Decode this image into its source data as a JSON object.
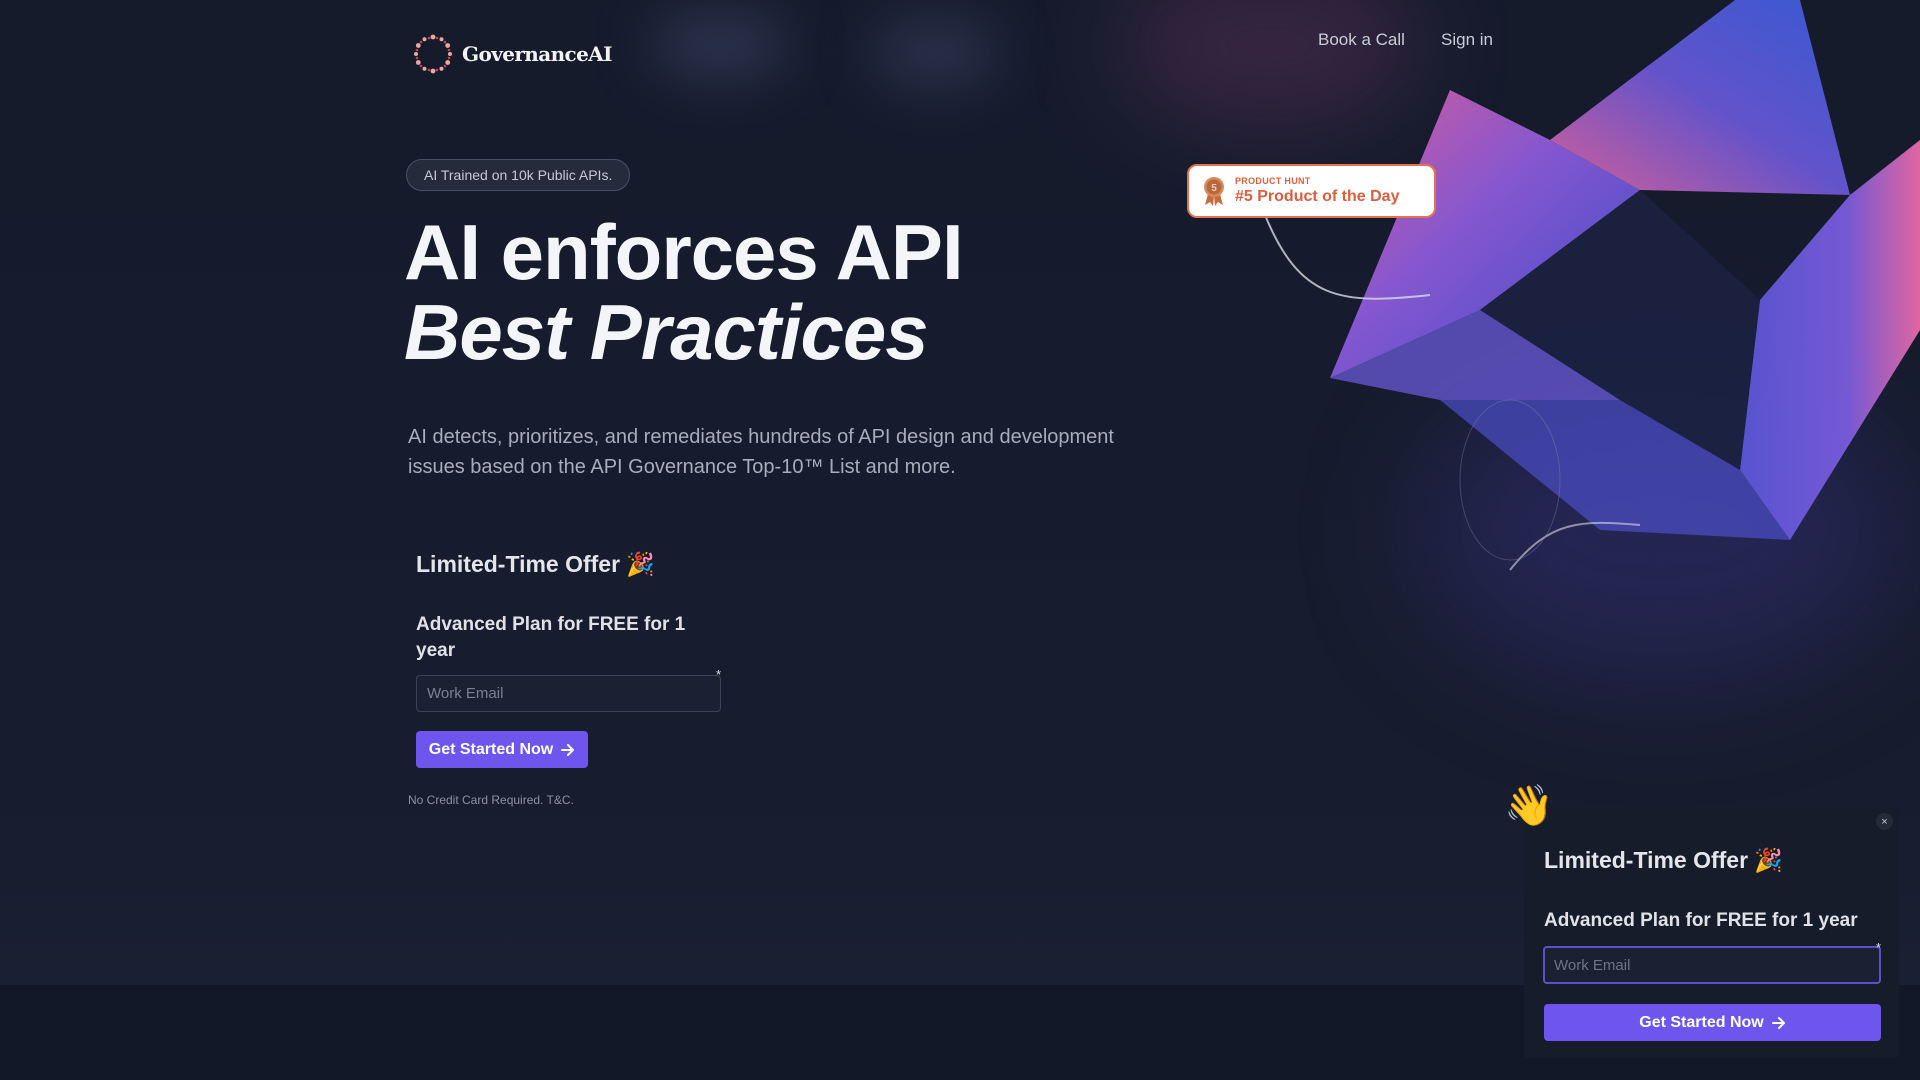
{
  "brand": {
    "name": "GovernanceAI",
    "accent": "#6d55ee"
  },
  "nav": {
    "book_call": "Book a Call",
    "sign_in": "Sign in"
  },
  "hero": {
    "pill": "AI Trained on 10k Public APIs.",
    "headline_line1": "AI enforces API",
    "headline_line2": "Best Practices",
    "subtext": "AI detects, prioritizes, and remediates hundreds of API design and development issues based on the API Governance Top-10™ List and more."
  },
  "form": {
    "offer_title": "Limited-Time Offer 🎉",
    "plan_title": "Advanced Plan for FREE for 1 year",
    "email_placeholder": "Work Email",
    "required_mark": "*",
    "cta_label": "Get Started Now",
    "fine_print": "No Credit Card Required. T&C."
  },
  "product_hunt": {
    "label": "PRODUCT HUNT",
    "title": "#5 Product of the Day",
    "medal_number": "5",
    "color": "#d95f3e"
  },
  "popup": {
    "wave": "👋",
    "close": "×",
    "offer_title": "Limited-Time Offer 🎉",
    "plan_title": "Advanced Plan for FREE for 1 year",
    "email_placeholder": "Work Email",
    "required_mark": "*",
    "cta_label": "Get Started Now"
  },
  "icons": {
    "cta_arrow": "arrow-right-icon"
  }
}
